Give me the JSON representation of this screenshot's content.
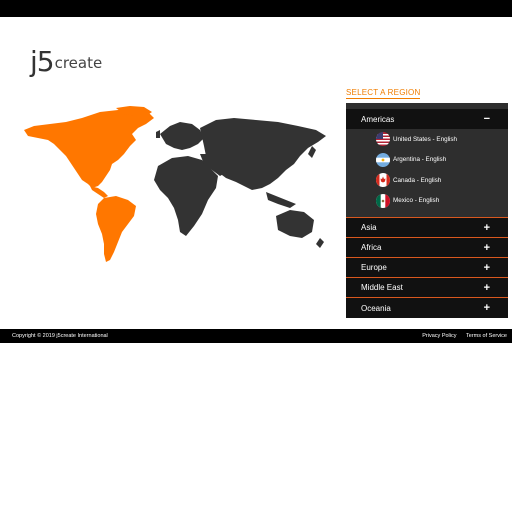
{
  "logo": {
    "mark": "j5",
    "word": "create"
  },
  "region": {
    "title": "SELECT A REGION",
    "sections": [
      {
        "label": "Americas",
        "state": "expanded",
        "symbol": "−",
        "countries": [
          {
            "label": "United States - English",
            "flag": "us-flag-icon"
          },
          {
            "label": "Argentina - English",
            "flag": "argentina-flag-icon"
          },
          {
            "label": "Canada - English",
            "flag": "canada-flag-icon"
          },
          {
            "label": "Mexico - English",
            "flag": "mexico-flag-icon"
          }
        ]
      },
      {
        "label": "Asia",
        "state": "collapsed",
        "symbol": "+"
      },
      {
        "label": "Africa",
        "state": "collapsed",
        "symbol": "+"
      },
      {
        "label": "Europe",
        "state": "collapsed",
        "symbol": "+"
      },
      {
        "label": "Middle East",
        "state": "collapsed",
        "symbol": "+"
      },
      {
        "label": "Oceania",
        "state": "collapsed",
        "symbol": "+"
      }
    ]
  },
  "map": {
    "highlighted_region": "Americas",
    "highlight_color": "#ff7700",
    "base_color": "#333333"
  },
  "footer": {
    "copyright": "Copyright © 2019 j5create International",
    "privacy": "Privacy Policy",
    "terms": "Terms of Service"
  },
  "colors": {
    "accent": "#f07d00",
    "panel_bg": "#111111",
    "panel_open_bg": "#2e2e2e",
    "divider": "#d9581f"
  }
}
